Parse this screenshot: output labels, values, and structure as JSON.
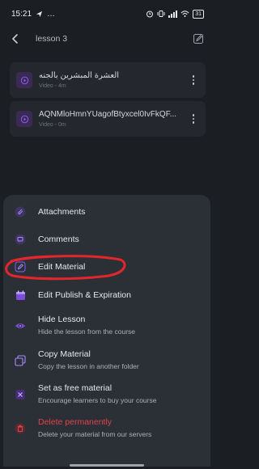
{
  "status_bar": {
    "time": "15:21",
    "extra": "…",
    "battery": "31"
  },
  "top_bar": {
    "title": "lesson 3"
  },
  "materials": [
    {
      "title": "العشرة المبشرين بالجنه",
      "subtitle": "Video - 4m"
    },
    {
      "title": "AQNMloHmnYUagofBtyxcel0IvFkQF...",
      "subtitle": "Video - 0m"
    }
  ],
  "menu": {
    "attachments": {
      "label": "Attachments"
    },
    "comments": {
      "label": "Comments"
    },
    "edit_material": {
      "label": "Edit Material"
    },
    "edit_publish": {
      "label": "Edit Publish & Expiration"
    },
    "hide_lesson": {
      "label": "Hide Lesson",
      "description": "Hide the lesson from the course"
    },
    "copy_material": {
      "label": "Copy Material",
      "description": "Copy the lesson in another folder"
    },
    "free_material": {
      "label": "Set as free material",
      "description": "Encourage learners to buy your course"
    },
    "delete": {
      "label": "Delete permanently",
      "description": "Delete your material from our servers"
    }
  },
  "colors": {
    "background": "#1b1e22",
    "sheet": "#2a3036",
    "accent_purple": "#8b5cf6",
    "danger": "#e0414b",
    "annotation": "#e3262c"
  }
}
